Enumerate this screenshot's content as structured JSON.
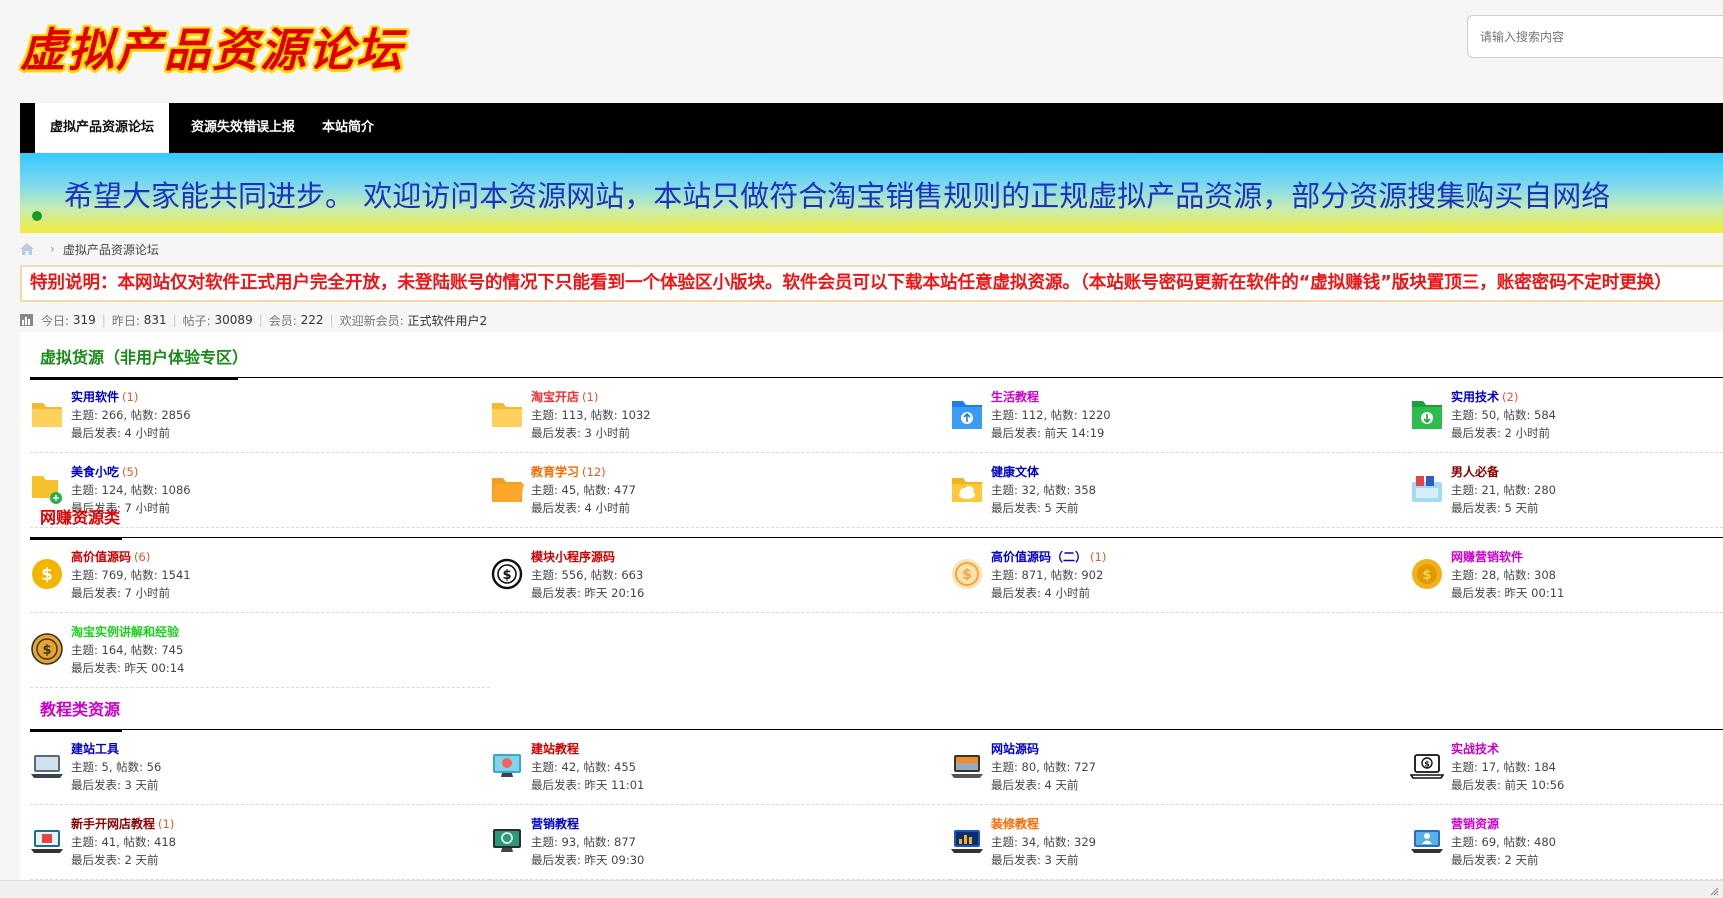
{
  "header": {
    "logo_text": "虚拟产品资源论坛",
    "search_placeholder": "请输入搜索内容"
  },
  "nav": {
    "items": [
      {
        "label": "虚拟产品资源论坛",
        "active": true
      },
      {
        "label": "资源失效错误上报",
        "active": false
      },
      {
        "label": "本站简介",
        "active": false
      }
    ]
  },
  "banner": {
    "text": "希望大家能共同进步。          欢迎访问本资源网站，本站只做符合淘宝销售规则的正规虚拟产品资源，部分资源搜集购买自网络"
  },
  "breadcrumb": {
    "current": "虚拟产品资源论坛"
  },
  "notice": {
    "text": "特别说明：本网站仅对软件正式用户完全开放，未登陆账号的情况下只能看到一个体验区小版块。软件会员可以下载本站任意虚拟资源。（本站账号密码更新在软件的“虚拟赚钱”版块置顶三，账密密码不定时更换）"
  },
  "stats": {
    "today_label": "今日:",
    "today": "319",
    "yesterday_label": "昨日:",
    "yesterday": "831",
    "posts_label": "帖子:",
    "posts": "30089",
    "members_label": "会员:",
    "members": "222",
    "welcome_label": "欢迎新会员:",
    "welcome_user": "正式软件用户2"
  },
  "sections": [
    {
      "title": "虚拟货源（非用户体验专区）",
      "color": "#1a8a1a",
      "forums": [
        {
          "name": "实用软件",
          "count": "(1)",
          "color": "#0000cc",
          "icon": "yellow-folder-icon",
          "topics": "主题: 266, 帖数: 2856",
          "last": "最后发表: 4 小时前"
        },
        {
          "name": "淘宝开店",
          "count": "(1)",
          "color": "#ff2a2a",
          "icon": "yellow-folder-icon",
          "topics": "主题: 113, 帖数: 1032",
          "last": "最后发表: 3 小时前"
        },
        {
          "name": "生活教程",
          "count": "",
          "color": "#cc00cc",
          "icon": "blue-upload-folder-icon",
          "topics": "主题: 112, 帖数: 1220",
          "last": "最后发表: 前天 14:19"
        },
        {
          "name": "实用技术",
          "count": "(2)",
          "color": "#0000cc",
          "icon": "green-download-folder-icon",
          "topics": "主题: 50, 帖数: 584",
          "last": "最后发表: 2 小时前"
        },
        {
          "name": "美食小吃",
          "count": "(5)",
          "color": "#0000cc",
          "icon": "folder-add-icon",
          "topics": "主题: 124, 帖数: 1086",
          "last": "最后发表: 7 小时前"
        },
        {
          "name": "教育学习",
          "count": "(12)",
          "color": "#ff6a00",
          "icon": "orange-folder-icon",
          "topics": "主题: 45, 帖数: 477",
          "last": "最后发表: 4 小时前"
        },
        {
          "name": "健康文体",
          "count": "",
          "color": "#0000cc",
          "icon": "cloud-folder-icon",
          "topics": "主题: 32, 帖数: 358",
          "last": "最后发表: 5 天前"
        },
        {
          "name": "男人必备",
          "count": "",
          "color": "#8b0000",
          "icon": "files-icon",
          "topics": "主题: 21, 帖数: 280",
          "last": "最后发表: 5 天前"
        }
      ]
    },
    {
      "title": "网赚资源类",
      "color": "#e00000",
      "forums": [
        {
          "name": "高价值源码",
          "count": "(6)",
          "color": "#cc0000",
          "icon": "dollar-coin-icon",
          "topics": "主题: 769, 帖数: 1541",
          "last": "最后发表: 7 小时前"
        },
        {
          "name": "模块小程序源码",
          "count": "",
          "color": "#cc0000",
          "icon": "dollar-outline-icon",
          "topics": "主题: 556, 帖数: 663",
          "last": "最后发表: 昨天 20:16"
        },
        {
          "name": "高价值源码（二）",
          "count": "(1)",
          "color": "#0000cc",
          "icon": "dollar-badge-icon",
          "topics": "主题: 871, 帖数: 902",
          "last": "最后发表: 4 小时前"
        },
        {
          "name": "网赚营销软件",
          "count": "",
          "color": "#cc00cc",
          "icon": "gold-coin-icon",
          "topics": "主题: 28, 帖数: 308",
          "last": "最后发表: 昨天 00:11"
        },
        {
          "name": "淘宝实例讲解和经验",
          "count": "",
          "color": "#1bd11b",
          "icon": "dollar-coin-outline-icon",
          "topics": "主题: 164, 帖数: 745",
          "last": "最后发表: 昨天 00:14"
        }
      ]
    },
    {
      "title": "教程类资源",
      "color": "#cc00cc",
      "forums": [
        {
          "name": "建站工具",
          "count": "",
          "color": "#0000cc",
          "icon": "laptop-icon",
          "topics": "主题: 5, 帖数: 56",
          "last": "最后发表: 3 天前"
        },
        {
          "name": "建站教程",
          "count": "",
          "color": "#cc0000",
          "icon": "monitor-icon",
          "topics": "主题: 42, 帖数: 455",
          "last": "最后发表: 昨天 11:01"
        },
        {
          "name": "网站源码",
          "count": "",
          "color": "#0000cc",
          "icon": "laptop-dark-icon",
          "topics": "主题: 80, 帖数: 727",
          "last": "最后发表: 4 天前"
        },
        {
          "name": "实战技术",
          "count": "",
          "color": "#cc00cc",
          "icon": "laptop-dollar-icon",
          "topics": "主题: 17, 帖数: 184",
          "last": "最后发表: 前天 10:56"
        },
        {
          "name": "新手开网店教程",
          "count": "(1)",
          "color": "#8b0000",
          "icon": "laptop-shop-icon",
          "topics": "主题: 41, 帖数: 418",
          "last": "最后发表: 2 天前"
        },
        {
          "name": "营销教程",
          "count": "",
          "color": "#0000cc",
          "icon": "monitor-recycle-icon",
          "topics": "主题: 93, 帖数: 877",
          "last": "最后发表: 昨天 09:30"
        },
        {
          "name": "装修教程",
          "count": "",
          "color": "#ff6a00",
          "icon": "laptop-chart-icon",
          "topics": "主题: 34, 帖数: 329",
          "last": "最后发表: 3 天前"
        },
        {
          "name": "营销资源",
          "count": "",
          "color": "#cc00cc",
          "icon": "laptop-user-icon",
          "topics": "主题: 69, 帖数: 480",
          "last": "最后发表: 2 天前"
        }
      ]
    }
  ]
}
